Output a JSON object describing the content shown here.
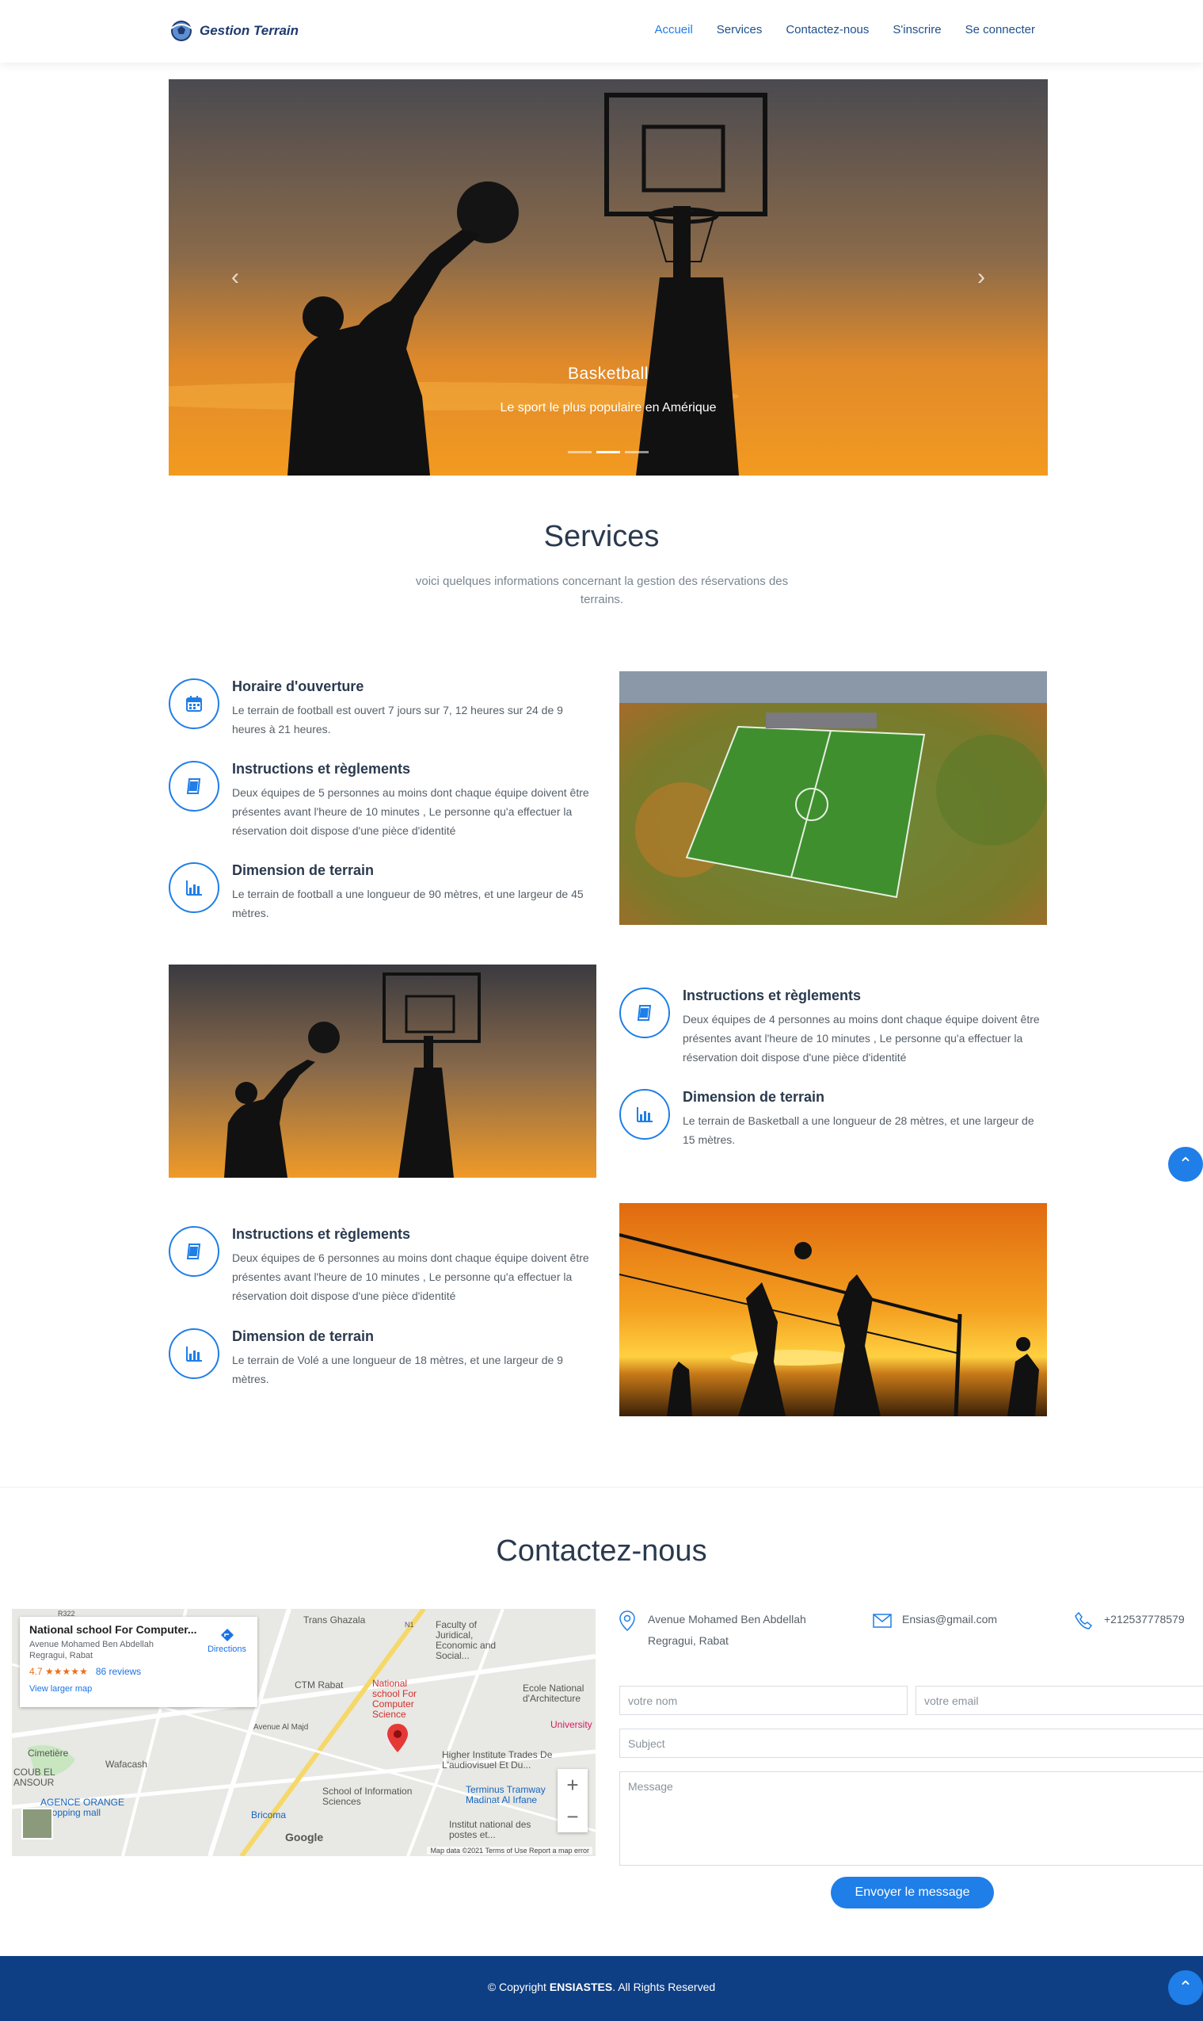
{
  "header": {
    "logo_text": "Gestion Terrain",
    "nav": [
      "Accueil",
      "Services",
      "Contactez-nous",
      "S'inscrire",
      "Se connecter"
    ]
  },
  "hero": {
    "title": "Basketball",
    "subtitle": "Le sport le plus populaire en Amérique",
    "slide_count": 3,
    "active_slide": 2
  },
  "services": {
    "title": "Services",
    "subtitle": "voici quelques informations concernant la gestion des réservations des terrains.",
    "football": [
      {
        "icon": "calendar-icon",
        "title": "Horaire d'ouverture",
        "text": "Le terrain de football est ouvert 7 jours sur 7, 12 heures sur 24 de 9 heures à 21 heures."
      },
      {
        "icon": "book-icon",
        "title": "Instructions et règlements",
        "text": "Deux équipes de 5 personnes au moins dont chaque équipe doivent être présentes avant l'heure de 10 minutes , Le personne qu'a effectuer la réservation doit dispose d'une pièce d'identité"
      },
      {
        "icon": "bar-chart-icon",
        "title": "Dimension de terrain",
        "text": "Le terrain de football a une longueur de 90 mètres, et une largeur de 45 mètres."
      }
    ],
    "basketball": [
      {
        "icon": "book-icon",
        "title": "Instructions et règlements",
        "text": "Deux équipes de 4 personnes au moins dont chaque équipe doivent être présentes avant l'heure de 10 minutes , Le personne qu'a effectuer la réservation doit dispose d'une pièce d'identité"
      },
      {
        "icon": "bar-chart-icon",
        "title": "Dimension de terrain",
        "text": "Le terrain de Basketball a une longueur de 28 mètres, et une largeur de 15 mètres."
      }
    ],
    "volleyball": [
      {
        "icon": "book-icon",
        "title": "Instructions et règlements",
        "text": "Deux équipes de 6 personnes au moins dont chaque équipe doivent être présentes avant l'heure de 10 minutes , Le personne qu'a effectuer la réservation doit dispose d'une pièce d'identité"
      },
      {
        "icon": "bar-chart-icon",
        "title": "Dimension de terrain",
        "text": "Le terrain de Volé a une longueur de 18 mètres, et une largeur de 9 mètres."
      }
    ]
  },
  "contact": {
    "title": "Contactez-nous",
    "address": "Avenue Mohamed Ben Abdellah Regragui, Rabat",
    "email": "Ensias@gmail.com",
    "phone": "+212537778579",
    "form": {
      "name_placeholder": "votre nom",
      "email_placeholder": "votre email",
      "subject_placeholder": "Subject",
      "message_placeholder": "Message",
      "submit_label": "Envoyer le message"
    },
    "map": {
      "place_title": "National school For Computer...",
      "place_address": "Avenue Mohamed Ben Abdellah Regragui, Rabat",
      "rating": "4.7",
      "stars": "★★★★★",
      "reviews": "86 reviews",
      "larger_map": "View larger map",
      "directions": "Directions",
      "pin_label": "National school For Computer Science",
      "labels": [
        "Trans Ghazala",
        "Faculty of Juridical, Economic and Social...",
        "CTM Rabat",
        "Ecole National d'Architecture",
        "University",
        "Higher Institute Trades De L'audiovisuel Et Du...",
        "School of Information Sciences",
        "Terminus Tramway Madinat Al Irfane",
        "Institut national des postes et...",
        "Cimetière",
        "Wafacash",
        "COUB EL ANSOUR",
        "AGENCE ORANGE Shopping mall",
        "Bricoma",
        "Avenue Al Majd",
        "R322",
        "N1"
      ],
      "google": "Google",
      "footer": "Map data ©2021   Terms of Use   Report a map error"
    }
  },
  "footer": {
    "prefix": "© Copyright ",
    "brand": "ENSIASTES",
    "suffix": ". All Rights Reserved"
  },
  "colors": {
    "accent": "#1f7ee8",
    "nav_text": "#1e4f8c",
    "heading": "#2a3a4e",
    "footer_bg": "#0e3f84"
  }
}
